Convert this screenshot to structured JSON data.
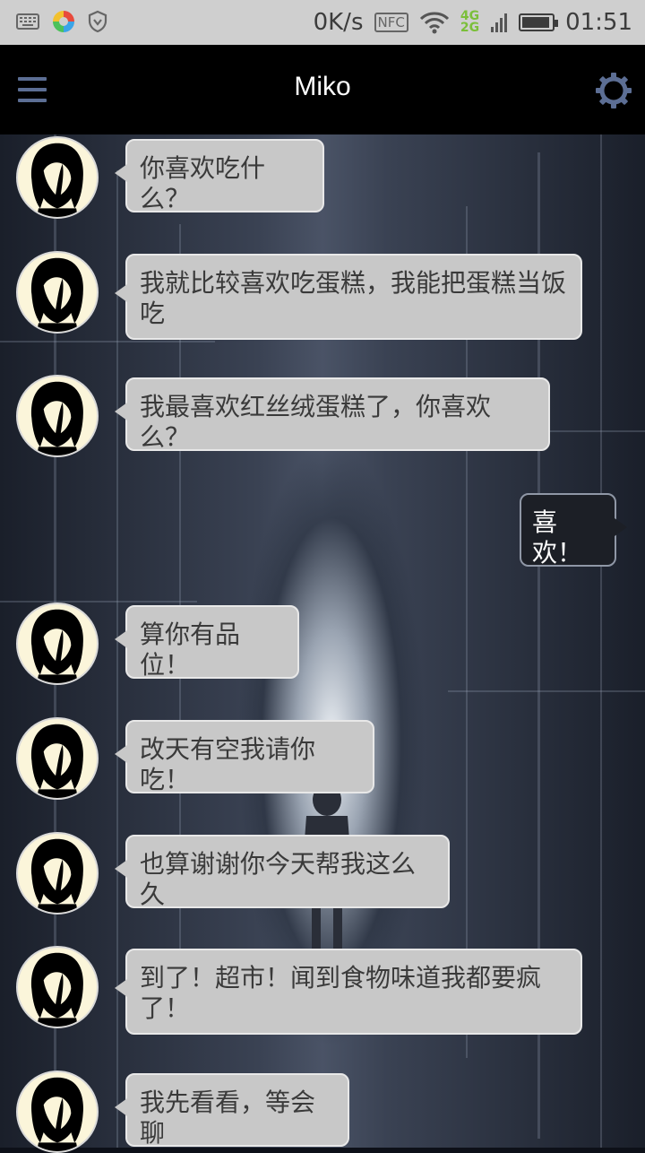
{
  "status_bar": {
    "speed": "0K/s",
    "nfc": "NFC",
    "net_4g": "4G",
    "net_2g": "2G",
    "battery_level": 0.95,
    "time": "01:51",
    "left_icons": [
      "keyboard-icon",
      "color-wheel-icon",
      "shield-icon"
    ]
  },
  "toolbar": {
    "title": "Miko",
    "menu_icon": "menu-icon",
    "settings_icon": "gear-icon"
  },
  "messages": [
    {
      "from": "miko",
      "text": "你喜欢吃什么？"
    },
    {
      "from": "miko",
      "text": "我就比较喜欢吃蛋糕，我能把蛋糕当饭吃"
    },
    {
      "from": "miko",
      "text": "我最喜欢红丝绒蛋糕了，你喜欢么？"
    },
    {
      "from": "me",
      "text": "喜欢！"
    },
    {
      "from": "miko",
      "text": "算你有品位！"
    },
    {
      "from": "miko",
      "text": "改天有空我请你吃！"
    },
    {
      "from": "miko",
      "text": "也算谢谢你今天帮我这么久"
    },
    {
      "from": "miko",
      "text": "到了！超市！闻到食物味道我都要疯了！"
    },
    {
      "from": "miko",
      "text": "我先看看，等会聊"
    }
  ],
  "colors": {
    "toolbar_bg": "#000000",
    "bubble_bg": "#c8c8c8",
    "my_bubble_bg": "#1c1f26",
    "accent": "#5c6e94"
  }
}
